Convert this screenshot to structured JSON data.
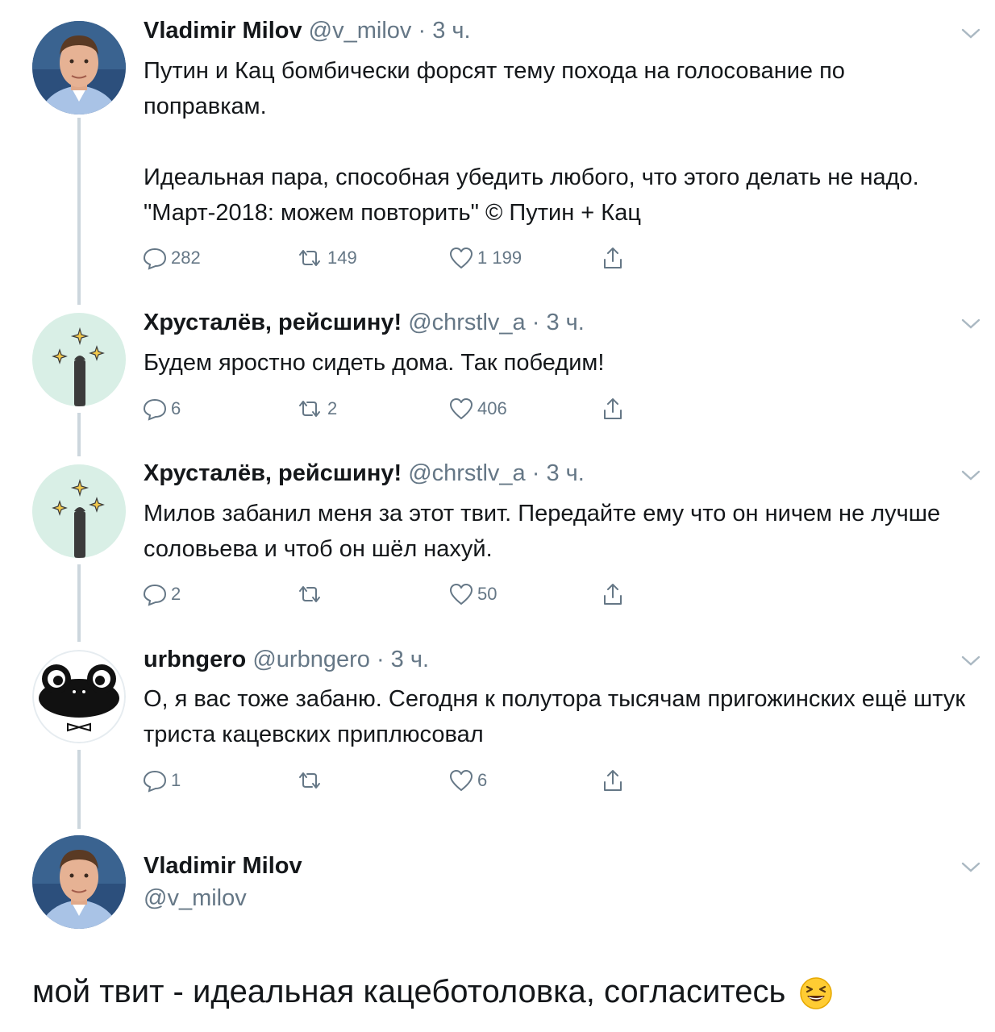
{
  "tweets": [
    {
      "name": "Vladimir Milov",
      "handle": "@v_milov",
      "dot": "·",
      "time": "3 ч.",
      "text": "Путин и Кац бомбически форсят тему похода на голосование по поправкам.\n\nИдеальная пара, способная убедить любого, что этого делать не надо. \"Март-2018: можем повторить\" © Путин + Кац",
      "replies": "282",
      "retweets": "149",
      "likes": "1 199",
      "avatar": "person-photo"
    },
    {
      "name": "Хрусталёв, рейсшину!",
      "handle": "@chrstlv_a",
      "dot": "·",
      "time": "3 ч.",
      "text": "Будем яростно сидеть дома. Так победим!",
      "replies": "6",
      "retweets": "2",
      "likes": "406",
      "avatar": "magic-wand-icon"
    },
    {
      "name": "Хрусталёв, рейсшину!",
      "handle": "@chrstlv_a",
      "dot": "·",
      "time": "3 ч.",
      "text": "Милов забанил меня за этот твит. Передайте ему что он ничем не лучше соловьева и чтоб он шёл нахуй.",
      "replies": "2",
      "retweets": "",
      "likes": "50",
      "avatar": "magic-wand-icon"
    },
    {
      "name": "urbngero",
      "handle": "@urbngero",
      "dot": "·",
      "time": "3 ч.",
      "text": "О, я вас тоже забаню. Сегодня к полутора тысячам пригожинских ещё штук триста кацевских приплюсовал",
      "replies": "1",
      "retweets": "",
      "likes": "6",
      "avatar": "frog-face-icon"
    }
  ],
  "last": {
    "name": "Vladimir Milov",
    "handle": "@v_milov"
  },
  "footer": {
    "text": "мой твит - идеальная кацеботоловка, согласитесь",
    "emoji": "grinning-squinting-face-emoji"
  },
  "colors": {
    "text": "#14171a",
    "muted": "#657786",
    "thread_line": "#ccd6dd",
    "mint_avatar": "#d9efe6"
  }
}
